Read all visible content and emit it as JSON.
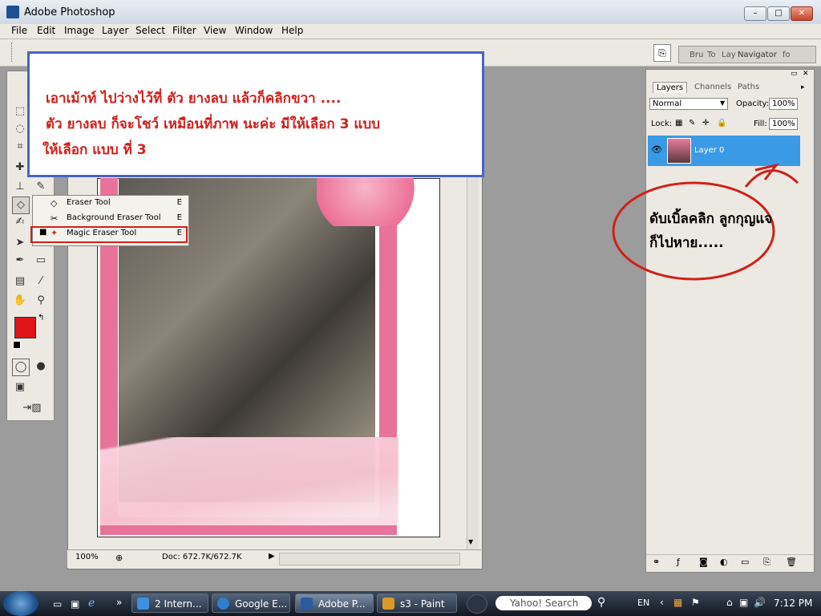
{
  "window": {
    "title": "Adobe Photoshop",
    "btn_min": "–",
    "btn_max": "□",
    "btn_close": "✕"
  },
  "menu": [
    "File",
    "Edit",
    "Image",
    "Layer",
    "Select",
    "Filter",
    "View",
    "Window",
    "Help"
  ],
  "options_bar": {
    "right_tabs": [
      "Bru",
      "To",
      "Lay",
      "Navigator",
      "fo"
    ]
  },
  "callout": {
    "line1": "เอาเม้าท์ ไปว่างไว้ที่ ตัว ยางลบ แล้วก็คลิกขวา ....",
    "line2": "ตัว ยางลบ ก็จะโชว์ เหมือนที่ภาพ นะค่ะ มีให้เลือก 3 แบบ",
    "line3": "ให้เลือก แบบ ที่ 3"
  },
  "flyout": [
    {
      "label": "Eraser Tool",
      "key": "E",
      "selected": false
    },
    {
      "label": "Background Eraser Tool",
      "key": "E",
      "selected": false
    },
    {
      "label": "Magic Eraser Tool",
      "key": "E",
      "selected": true
    }
  ],
  "doc_status": {
    "zoom": "100%",
    "doc": "Doc: 672.7K/672.7K"
  },
  "layers_panel": {
    "tabs": [
      "Layers",
      "Channels",
      "Paths"
    ],
    "blend_mode": "Normal",
    "opacity_label": "Opacity:",
    "opacity_value": "100%",
    "lock_label": "Lock:",
    "fill_label": "Fill:",
    "fill_value": "100%",
    "layer_name": "Layer 0"
  },
  "note": {
    "line1": "ดับเบิ้ลคลิก ลูกกุญแจ",
    "line2": "ก็ไปหาย....."
  },
  "taskbar": {
    "buttons": [
      "2 Intern...",
      "Google E...",
      "Adobe P...",
      "s3 - Paint"
    ],
    "search_placeholder": "Yahoo! Search",
    "lang": "EN",
    "time": "7:12 PM"
  },
  "colors": {
    "foreground": "#e0141a",
    "background": "#ffffff",
    "accent_callout": "#4a62c6",
    "highlight": "#d0201a",
    "layer_selected": "#3a9ae6"
  }
}
